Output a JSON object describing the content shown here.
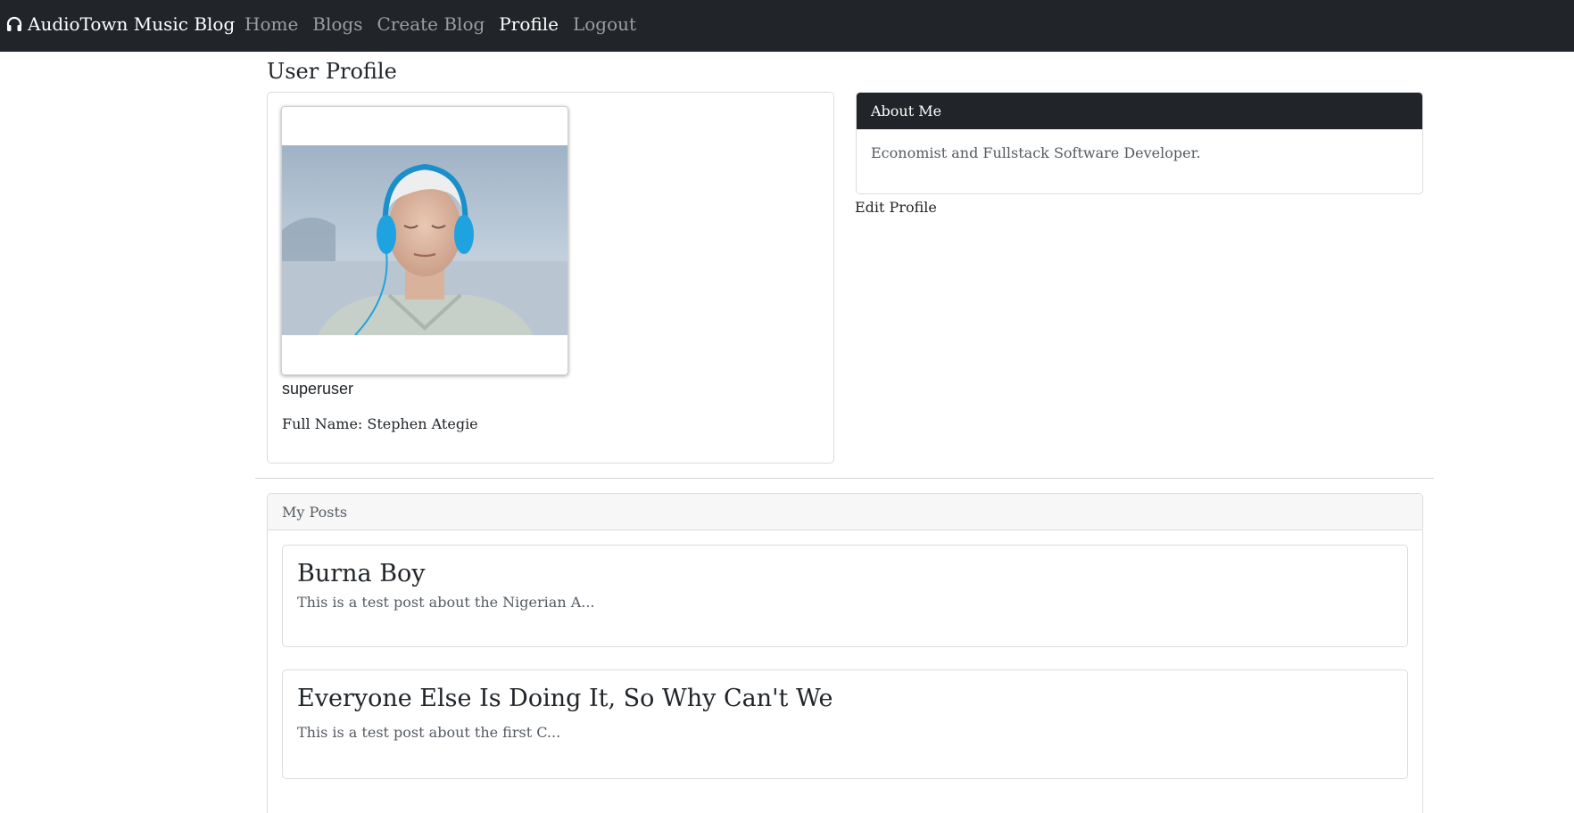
{
  "navbar": {
    "brand_icon": "headphones-icon",
    "brand": "AudioTown Music Blog",
    "links": [
      {
        "label": "Home",
        "active": false
      },
      {
        "label": "Blogs",
        "active": false
      },
      {
        "label": "Create Blog",
        "active": false
      },
      {
        "label": "Profile",
        "active": true
      },
      {
        "label": "Logout",
        "active": false
      }
    ]
  },
  "page": {
    "title": "User Profile"
  },
  "profile": {
    "username": "superuser",
    "full_name": "Full Name: Stephen Ategie"
  },
  "about": {
    "header": "About Me",
    "body": "Economist and Fullstack Software Developer.",
    "edit_link": "Edit Profile"
  },
  "posts": {
    "header": "My Posts",
    "items": [
      {
        "title": "Burna Boy",
        "excerpt": "This is a test post about the Nigerian A..."
      },
      {
        "title": "Everyone Else Is Doing It, So Why Can't We",
        "excerpt": "This is a test post about the first C..."
      }
    ]
  },
  "colors": {
    "navbar_bg": "#212529",
    "nav_active": "#ffffff",
    "nav_inactive": "rgba(255,255,255,0.55)",
    "muted_text": "#555b62"
  }
}
